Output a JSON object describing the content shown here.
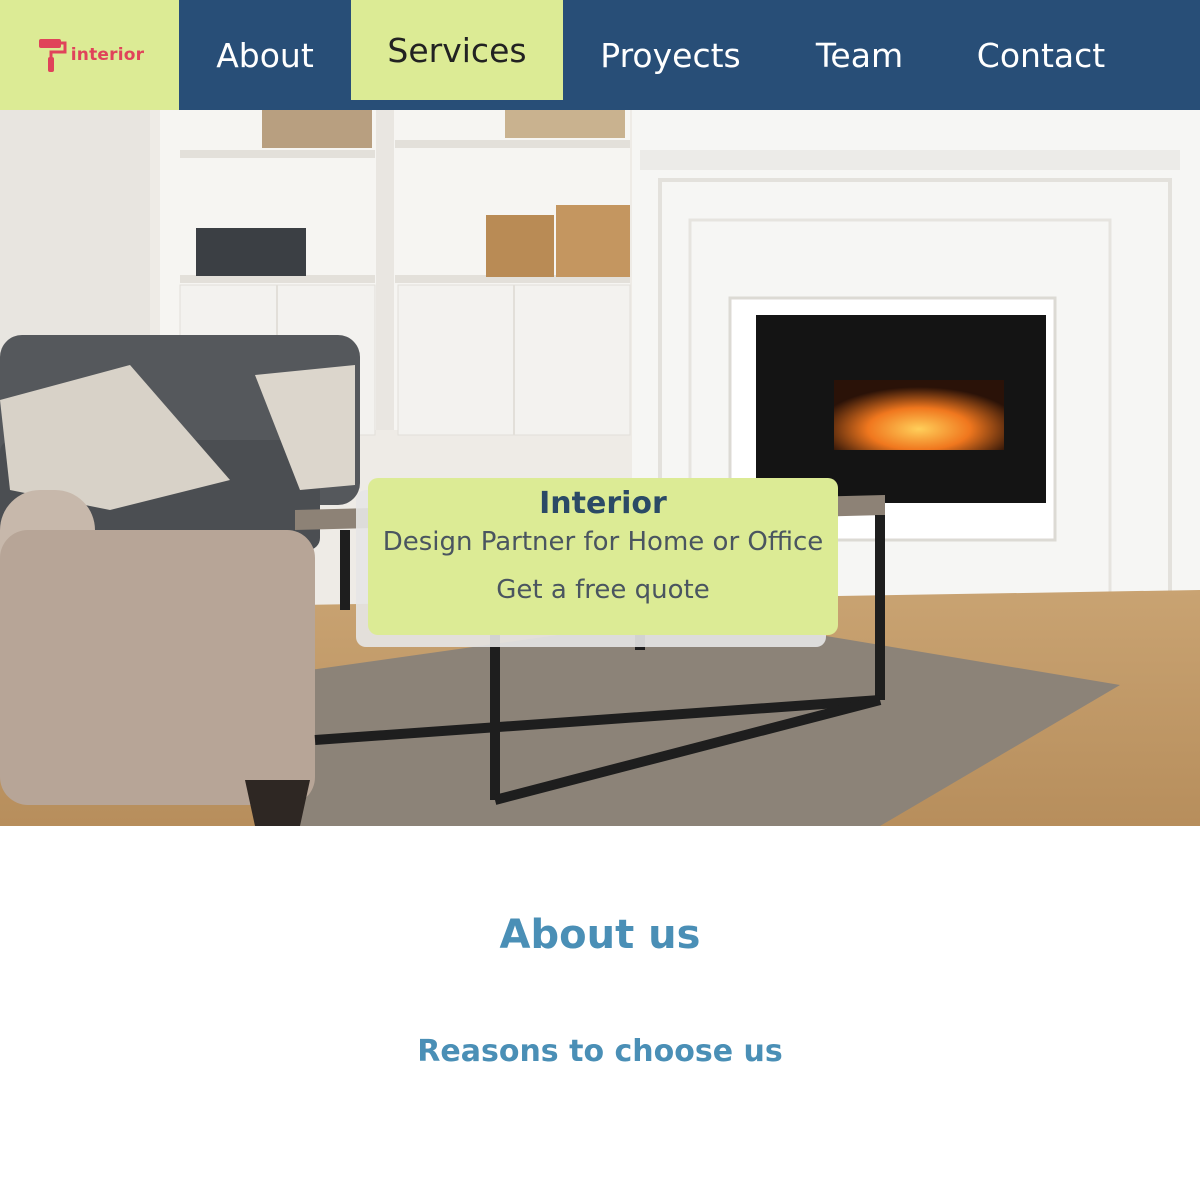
{
  "brand": {
    "logo_text": "interior",
    "logo_icon": "paint-roller-icon",
    "logo_color": "#e0435a"
  },
  "nav": {
    "items": [
      {
        "label": "About",
        "active": false
      },
      {
        "label": "Services",
        "active": true
      },
      {
        "label": "Proyects",
        "active": false
      },
      {
        "label": "Team",
        "active": false
      },
      {
        "label": "Contact",
        "active": false
      }
    ]
  },
  "hero": {
    "title": "Interior",
    "subtitle": "Design Partner for Home or Office",
    "cta": "Get a free quote"
  },
  "about": {
    "title": "About us",
    "reasons_title": "Reasons to choose us"
  },
  "colors": {
    "nav_bg": "#284e77",
    "accent": "#dceb95",
    "heading": "#4a8fb6"
  }
}
